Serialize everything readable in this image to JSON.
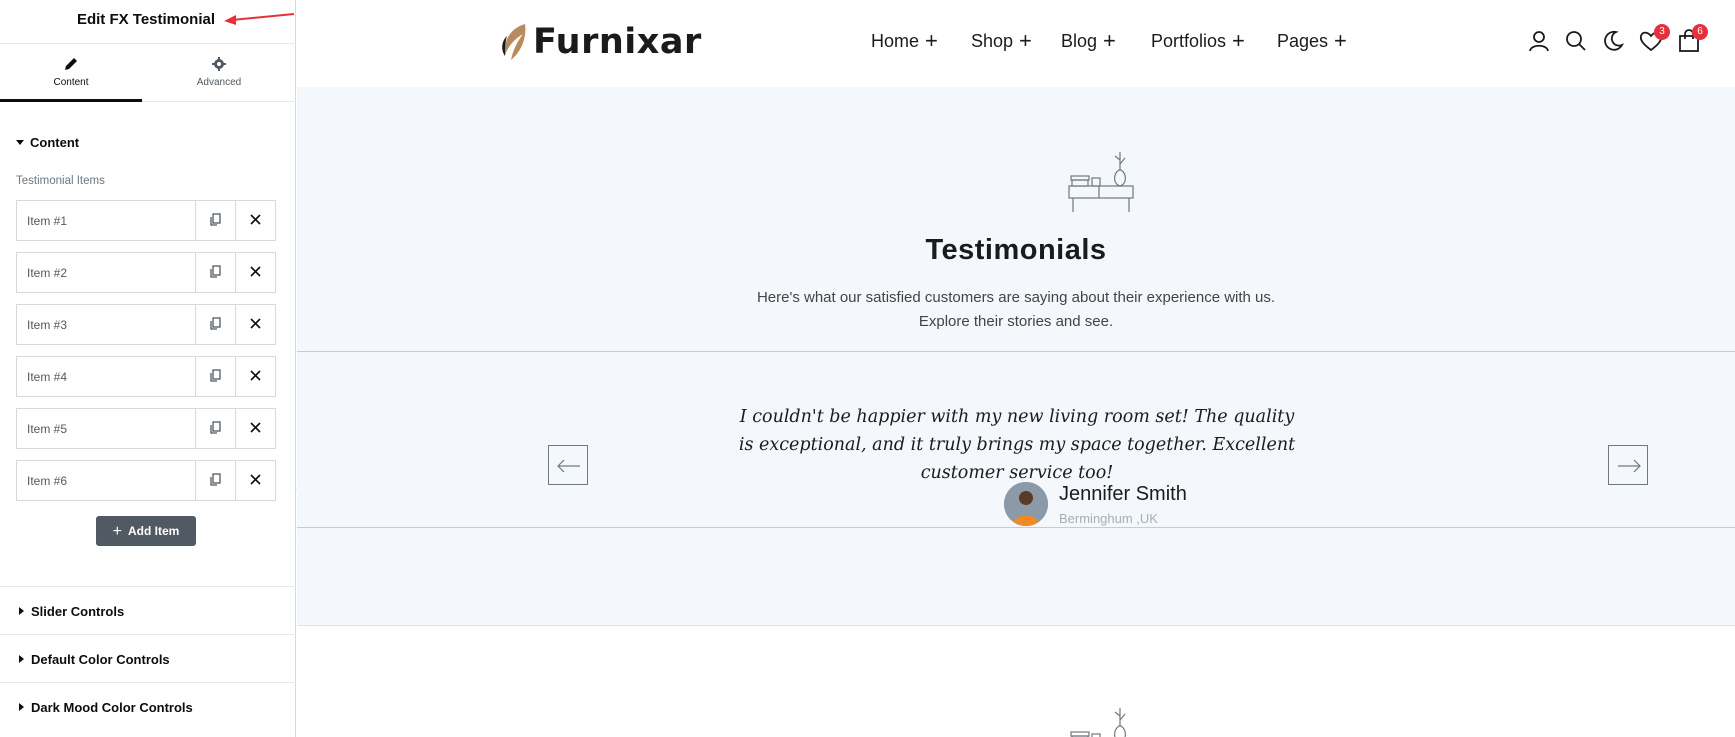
{
  "panel": {
    "title": "Edit FX Testimonial",
    "tabs": [
      {
        "label": "Content",
        "icon": "pencil-icon",
        "active": true
      },
      {
        "label": "Advanced",
        "icon": "gear-icon",
        "active": false
      }
    ],
    "content_section": {
      "label": "Content",
      "field_label": "Testimonial Items",
      "items": [
        "Item #1",
        "Item #2",
        "Item #3",
        "Item #4",
        "Item #5",
        "Item #6"
      ],
      "add_label": "Add Item"
    },
    "sections": [
      "Slider Controls",
      "Default Color Controls",
      "Dark Mood Color Controls"
    ]
  },
  "site": {
    "logo_text": "Furnixar",
    "nav": [
      "Home",
      "Shop",
      "Blog",
      "Portfolios",
      "Pages"
    ],
    "nav_plus": "+",
    "wishlist_count": "3",
    "cart_count": "6"
  },
  "testimonials": {
    "title": "Testimonials",
    "subtitle_line1": "Here's what our satisfied customers are saying about their experience with us.",
    "subtitle_line2": "Explore their stories and see.",
    "quote": "I couldn't be happier with my new living room set! The quality is exceptional, and it truly brings my space together. Excellent customer service too!",
    "author_name": "Jennifer Smith",
    "author_location": "Berminghum ,UK"
  },
  "colors": {
    "accent_red": "#e8303d",
    "section_bg": "#f4f8fc",
    "slide_border": "#e8b8e4",
    "add_button_bg": "#515962"
  }
}
